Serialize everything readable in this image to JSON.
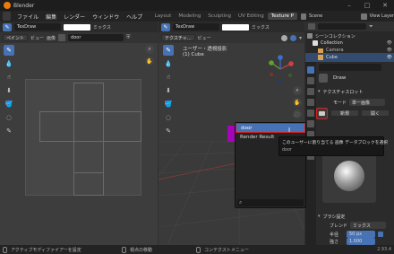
{
  "app": {
    "title": "Blender"
  },
  "menubar": {
    "items": [
      "ファイル",
      "編集",
      "レンダー",
      "ウィンドウ",
      "ヘルプ"
    ],
    "workspaces": [
      "Layout",
      "Modeling",
      "Sculpting",
      "UV Editing",
      "Texture P"
    ],
    "scene_label": "Scene",
    "view_layer_label": "View Layer"
  },
  "image_editor": {
    "header": {
      "brush_name": "TexDraw",
      "mix_label": "ミックス",
      "paint_label": "ペイント",
      "view_label": "ビュー",
      "image_label": "画像",
      "image_name": "door"
    }
  },
  "viewport": {
    "header": {
      "mode_label": "テクスチャ...",
      "view_label": "ビュー",
      "brush_name": "TexDraw",
      "mix_label": "ミックス"
    },
    "overlay_title": "ユーザー・透視投影",
    "overlay_object": "(1) Cube"
  },
  "outliner": {
    "title": "シーンコレクション",
    "items": [
      "Collection",
      "Camera",
      "Cube"
    ]
  },
  "properties": {
    "brush_label": "Draw",
    "texture_slots_label": "テクスチャスロット",
    "mode_label": "モード",
    "mode_value": "単一画像",
    "new_button": "新規",
    "open_button": "開く",
    "brush_settings_label": "ブラシ設定",
    "blend_label": "ブレンド",
    "blend_value": "ミックス",
    "radius_label": "半径",
    "radius_value": "50 px",
    "strength_label": "強さ",
    "strength_value": "1.000"
  },
  "image_browser": {
    "items": [
      "door",
      "Render Result"
    ],
    "selected": "door",
    "tooltip_line1": "このユーザーに割り当てる 画像 データブロックを選択",
    "tooltip_line2": "door"
  },
  "statusbar": {
    "left": "アクティブモディファイアーを設定",
    "middle": "視点の移動",
    "right": "コンテクストメニュー",
    "version": "2.93.4"
  },
  "colors": {
    "accent": "#4772b3",
    "cube": "#b000c8",
    "highlight": "#d22020"
  }
}
